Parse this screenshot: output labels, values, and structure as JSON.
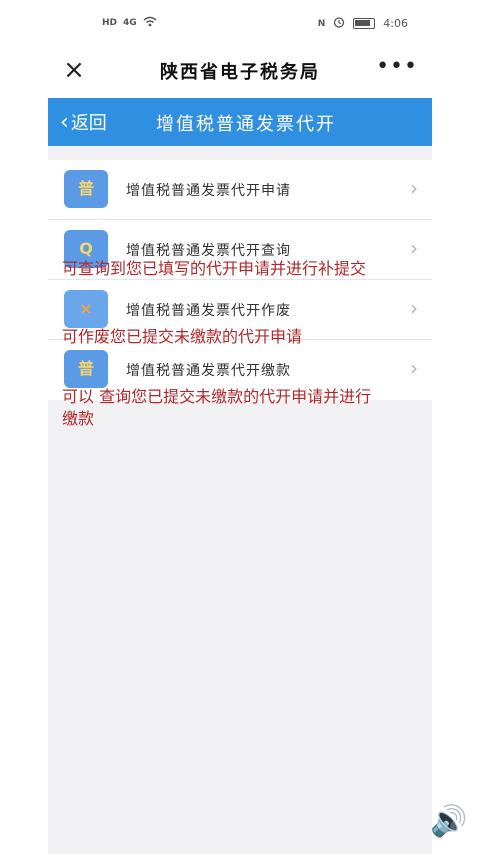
{
  "status": {
    "left_icons": [
      "HD",
      "4G",
      "wifi"
    ],
    "right_icons": [
      "N",
      "alarm",
      "battery"
    ],
    "time": "4:06"
  },
  "nav": {
    "close_icon": "×",
    "title": "陕西省电子税务局",
    "more_icon": "•••"
  },
  "subheader": {
    "back_label": "返回",
    "title": "增值税普通发票代开"
  },
  "menu": [
    {
      "icon": "普",
      "label": "增值税普通发票代开申请"
    },
    {
      "icon": "Q",
      "label": "增值税普通发票代开查询"
    },
    {
      "icon": "×",
      "label": "增值税普通发票代开作废"
    },
    {
      "icon": "普",
      "label": "增值税普通发票代开缴款"
    }
  ],
  "annotations": [
    "可查询到您已填写的代开申请并进行补提交",
    "可作废您已提交未缴款的代开申请",
    "可以 查询您已提交未缴款的代开申请并进行缴款"
  ],
  "speaker_icon": "🔊"
}
